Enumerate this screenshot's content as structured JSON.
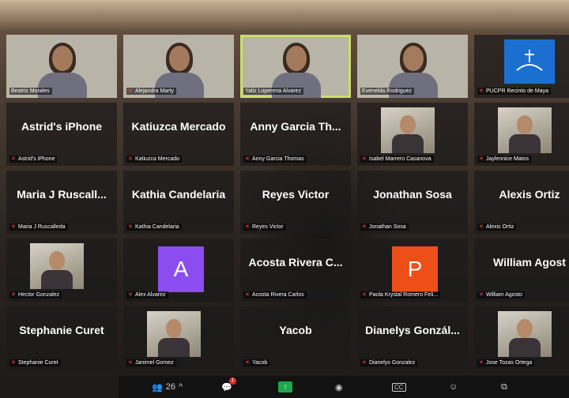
{
  "colors": {
    "active_speaker_outline": "#c8e06a",
    "muted_icon": "#ff4a4a",
    "avatar_purple": "#8b4cf0",
    "avatar_orange": "#ee4e17",
    "share_green": "#1fa54a",
    "chat_badge": "#e02f2f"
  },
  "participants": [
    {
      "label": "Beatriz Morales",
      "display": "",
      "kind": "video",
      "muted": false
    },
    {
      "label": "Alejandra Marty",
      "display": "",
      "kind": "video",
      "muted": true
    },
    {
      "label": "Yaliz Loperena Alvarez",
      "display": "",
      "kind": "video",
      "muted": false,
      "active": true
    },
    {
      "label": "Evenelda Rodriguez",
      "display": "",
      "kind": "video",
      "muted": false
    },
    {
      "label": "PUCPR Recinto de Maya",
      "display": "",
      "kind": "logo",
      "muted": true
    },
    {
      "label": "Astrid's iPhone",
      "display": "Astrid's iPhone",
      "kind": "name",
      "muted": true
    },
    {
      "label": "Katiuzca Mercado",
      "display": "Katiuzca Mercado",
      "kind": "name",
      "muted": true
    },
    {
      "label": "Anny Garcia Thomas",
      "display": "Anny Garcia Th...",
      "kind": "name",
      "muted": true
    },
    {
      "label": "Isabel Marrero Casanova",
      "display": "",
      "kind": "photo",
      "muted": true
    },
    {
      "label": "Jaylennice Matos",
      "display": "",
      "kind": "photo",
      "muted": true
    },
    {
      "label": "Maria J Ruscalleda",
      "display": "Maria J Ruscall...",
      "kind": "name",
      "muted": true
    },
    {
      "label": "Kathia Candelaria",
      "display": "Kathia Candelaria",
      "kind": "name",
      "muted": true
    },
    {
      "label": "Reyes Victor",
      "display": "Reyes Victor",
      "kind": "name",
      "muted": true
    },
    {
      "label": "Jonathan Sosa",
      "display": "Jonathan Sosa",
      "kind": "name",
      "muted": true
    },
    {
      "label": "Alexis Ortiz",
      "display": "Alexis Ortiz",
      "kind": "name",
      "muted": true
    },
    {
      "label": "Hector Gonzalez",
      "display": "",
      "kind": "photo",
      "muted": true
    },
    {
      "label": "Alex Alvarez",
      "display": "A",
      "kind": "avatar",
      "avatar_color": "#8b4cf0",
      "muted": true
    },
    {
      "label": "Acosta Rivera Carlos",
      "display": "Acosta Rivera C...",
      "kind": "name",
      "muted": true
    },
    {
      "label": "Paola Krystal Romero Feli...",
      "display": "P",
      "kind": "avatar",
      "avatar_color": "#ee4e17",
      "muted": true
    },
    {
      "label": "William Agosto",
      "display": "William Agost",
      "kind": "name",
      "muted": true
    },
    {
      "label": "Stephanie Curet",
      "display": "Stephanie Curet",
      "kind": "name",
      "muted": true
    },
    {
      "label": "Janimel Gomez",
      "display": "",
      "kind": "photo",
      "muted": true
    },
    {
      "label": "Yacob",
      "display": "Yacob",
      "kind": "name",
      "muted": true
    },
    {
      "label": "Dianelys Gonzalez",
      "display": "Dianelys Gonzál...",
      "kind": "name",
      "muted": true
    },
    {
      "label": "Jose Tozas Ortega",
      "display": "",
      "kind": "photo",
      "muted": true
    }
  ],
  "toolbar": {
    "participants_count": "26",
    "participants_chevron": "^",
    "chat_badge": "1",
    "items": [
      "participants-icon",
      "chat-icon",
      "share-screen-icon",
      "record-icon",
      "captions-icon",
      "reactions-icon",
      "more-icon"
    ],
    "captions_label": "CC"
  }
}
